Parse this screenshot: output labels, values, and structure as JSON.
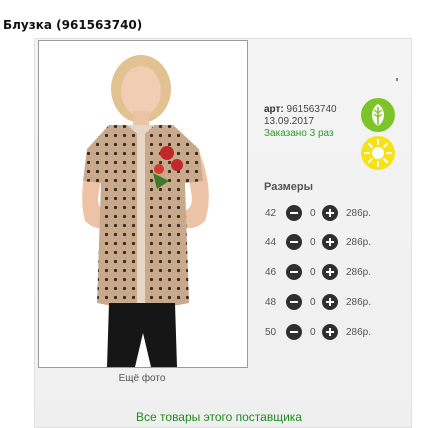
{
  "product": {
    "title": "Блузка (961563740)",
    "article_label": "арт:",
    "article_value": "961563740",
    "date": "13.09.2017",
    "ordered": "Заказано 3 раз"
  },
  "gallery": {
    "more_photos": "Ещё фото"
  },
  "sizes": {
    "title": "Размеры",
    "rows": [
      {
        "size": "42",
        "qty": "0",
        "price": "286р."
      },
      {
        "size": "44",
        "qty": "0",
        "price": "286р."
      },
      {
        "size": "46",
        "qty": "0",
        "price": "286р."
      },
      {
        "size": "48",
        "qty": "0",
        "price": "286р."
      },
      {
        "size": "50",
        "qty": "0",
        "price": "286р."
      }
    ]
  },
  "footer": {
    "supplier_link": "Все товары этого поставщика"
  },
  "colors": {
    "leaf": "#7dc32a",
    "sun": "#f7e21a",
    "link": "#1f8a1f"
  }
}
